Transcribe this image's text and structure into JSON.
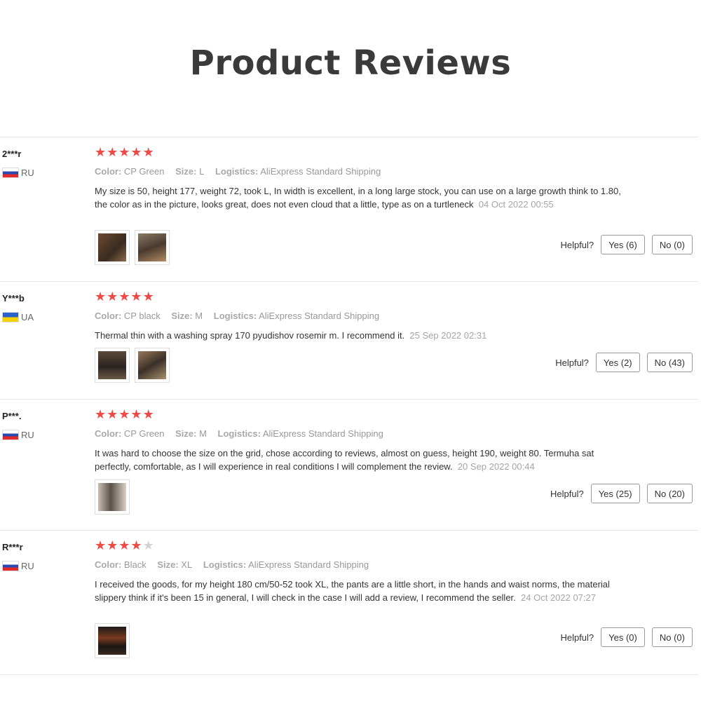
{
  "page": {
    "title": "Product Reviews"
  },
  "labels": {
    "color": "Color:",
    "size": "Size:",
    "logistics": "Logistics:",
    "helpful": "Helpful?"
  },
  "reviews": [
    {
      "user": "2***r",
      "country": "RU",
      "flag": "ru",
      "rating": 5,
      "color": "CP Green",
      "size": "L",
      "logistics": "AliExpress Standard Shipping",
      "text": "My size is 50, height 177, weight 72, took L, In width is excellent, in a long large stock, you can use on a large growth think to 1.80, the color as in the picture, looks great, does not even cloud that a little, type as on a turtleneck",
      "date": "04 Oct 2022 00:55",
      "yes": "Yes (6)",
      "no": "No (0)",
      "photos": 2
    },
    {
      "user": "Y***b",
      "country": "UA",
      "flag": "ua",
      "rating": 5,
      "color": "CP black",
      "size": "M",
      "logistics": "AliExpress Standard Shipping",
      "text": "Thermal thin with a washing spray 170 pyudishov rosemir m. I recommend it.",
      "date": "25 Sep 2022 02:31",
      "yes": "Yes (2)",
      "no": "No (43)",
      "photos": 2
    },
    {
      "user": "P***.",
      "country": "RU",
      "flag": "ru",
      "rating": 5,
      "color": "CP Green",
      "size": "M",
      "logistics": "AliExpress Standard Shipping",
      "text": "It was hard to choose the size on the grid, chose according to reviews, almost on guess, height 190, weight 80. Termuha sat perfectly, comfortable, as I will experience in real conditions I will complement the review.",
      "date": "20 Sep 2022 00:44",
      "yes": "Yes (25)",
      "no": "No (20)",
      "photos": 1
    },
    {
      "user": "R***r",
      "country": "RU",
      "flag": "ru",
      "rating": 4,
      "color": "Black",
      "size": "XL",
      "logistics": "AliExpress Standard Shipping",
      "text": "I received the goods, for my height 180 cm/50-52 took XL, the pants are a little short, in the hands and waist norms, the material slippery think if it's been 15 in general, I will check in the case I will add a review, I recommend the seller.",
      "date": "24 Oct 2022 07:27",
      "yes": "Yes (0)",
      "no": "No (0)",
      "photos": 1
    }
  ],
  "colors": {
    "star_on": "#f04a46",
    "star_off": "#d3d3d3",
    "title": "#3a3a3a"
  }
}
